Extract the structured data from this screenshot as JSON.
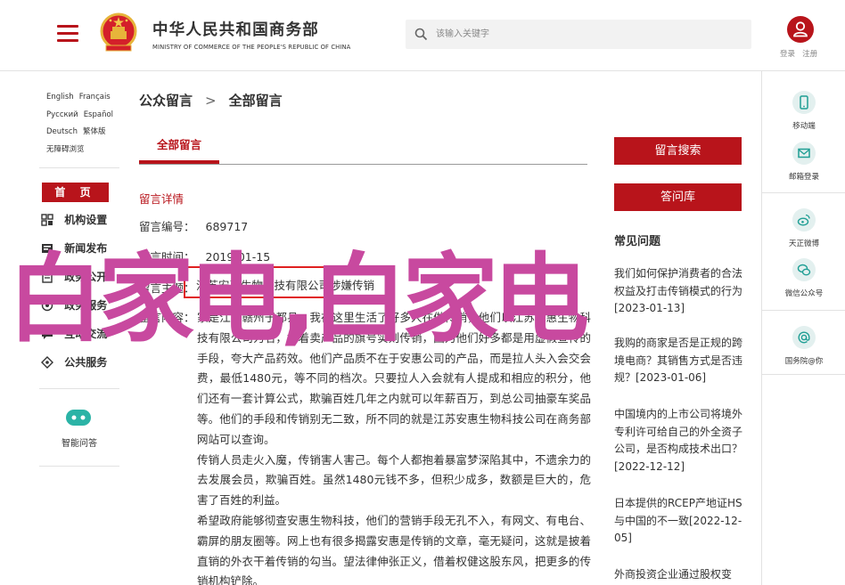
{
  "header": {
    "brand_cn": "中华人民共和国商务部",
    "brand_en": "MINISTRY OF COMMERCE OF THE PEOPLE'S REPUBLIC OF CHINA",
    "search_placeholder": "该输入关键字",
    "login": "登录",
    "register": "注册",
    "accent": "#b8141b"
  },
  "left": {
    "langs": [
      [
        "English",
        "Français"
      ],
      [
        "Русский",
        "Español"
      ],
      [
        "Deutsch",
        "繁体版"
      ],
      [
        "无障碍浏览"
      ]
    ],
    "home": "首 页",
    "items": [
      {
        "label": "机构设置",
        "icon": "org-grid-icon"
      },
      {
        "label": "新闻发布",
        "icon": "news-icon"
      },
      {
        "label": "政务公开",
        "icon": "gov-info-icon"
      },
      {
        "label": "政务服务",
        "icon": "service-icon"
      },
      {
        "label": "互动交流",
        "icon": "interaction-icon"
      },
      {
        "label": "公共服务",
        "icon": "public-service-icon"
      }
    ],
    "ai_label": "智能问答"
  },
  "main": {
    "breadcrumb": [
      "公众留言",
      "全部留言"
    ],
    "tab": "全部留言",
    "section_title": "留言详情",
    "number_label": "留言编号：",
    "number": "689717",
    "time_label": "留言时间：",
    "time": "2019-01-15",
    "subject_label": "留言主题：",
    "subject": "江苏安惠生物科技有限公司涉嫌传销",
    "content_label": "留言内容：",
    "paragraphs": [
      "家是江西赣州于都县，我在这里生活了好多人在做传销，他们以江苏安惠生物科技有限公司为名，打着卖产品的旗号实则传销，因为他们好多都是用虚假宣传的手段，夸大产品药效。他们产品质不在于安惠公司的产品，而是拉人头入会交会费，最低1480元，等不同的档次。只要拉人入会就有人提成和相应的积分，他们还有一套计算公式，欺骗百姓几年之内就可以年薪百万，到总公司抽豪车奖品等。他们的手段和传销别无二致，所不同的就是江苏安惠生物科技公司在商务部网站可以查询。",
      "传销人员走火入魔，传销害人害己。每个人都抱着暴富梦深陷其中，不遗余力的去发展会员，欺骗百姓。虽然1480元钱不多，但积少成多，数额是巨大的，危害了百姓的利益。",
      "希望政府能够彻查安惠生物科技，他们的营销手段无孔不入，有网文、有电台、霸屏的朋友圈等。网上也有很多揭露安惠是传销的文章，毫无疑问，这就是披着直销的外衣干着传销的勾当。望法律伸张正义，借着权健这股东风，把更多的传销机构铲除。"
    ]
  },
  "right": {
    "search_button": "留言搜索",
    "qa_button": "答问库",
    "faq_title": "常见问题",
    "faq": [
      "我们如何保护消费者的合法权益及打击传销模式的行为[2023-01-13]",
      "我购的商家是否是正规的跨境电商？其销售方式是否违规？[2023-01-06]",
      "中国境内的上市公司将境外专利许可给自己的外全资子公司，是否构成技术出口？[2022-12-12]",
      "日本提供的RCEP产地证HS与中国的不一致[2022-12-05]",
      "外商投资企业通过股权变"
    ]
  },
  "utility": [
    {
      "label": "移动端",
      "icon": "mobile-icon"
    },
    {
      "label": "邮箱登录",
      "icon": "mail-icon"
    },
    {
      "label": "天正微博",
      "icon": "weibo-icon"
    },
    {
      "label": "微信公众号",
      "icon": "wechat-icon"
    },
    {
      "label": "国务院@你",
      "icon": "at-icon"
    }
  ],
  "overlay_text": "白家电,白家电"
}
